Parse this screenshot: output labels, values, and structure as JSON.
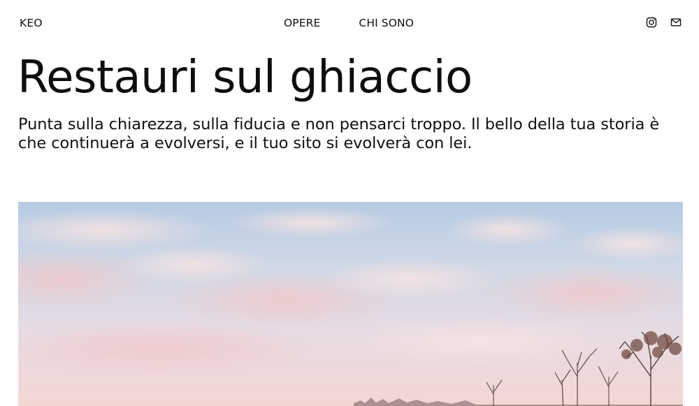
{
  "header": {
    "logo": "KEO",
    "nav": [
      {
        "label": "OPERE"
      },
      {
        "label": "CHI SONO"
      }
    ],
    "social": {
      "instagram_icon": "instagram-icon",
      "mail_icon": "mail-icon"
    }
  },
  "hero": {
    "title": "Restauri sul ghiaccio",
    "subtitle": "Punta sulla chiarezza, sulla fiducia e non pensarci troppo. Il bello della tua storia è che continuerà a evolversi, e il tuo sito si evolverà con lei."
  },
  "colors": {
    "text": "#111111",
    "background": "#ffffff",
    "sky_top": "#bccde0",
    "sky_bottom": "#f5d7d3"
  }
}
